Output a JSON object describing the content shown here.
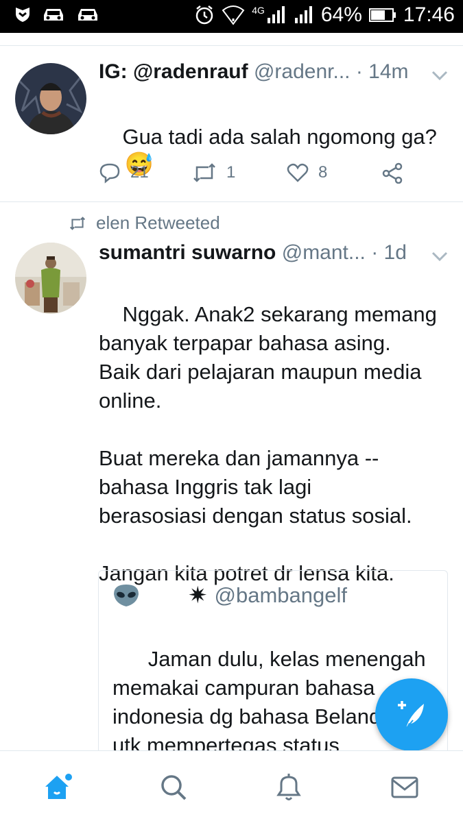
{
  "status_bar": {
    "network": "4G",
    "battery": "64%",
    "time": "17:46"
  },
  "tweets": [
    {
      "name": "IG: @radenrauf",
      "handle": "@radenr...",
      "time": "· 14m",
      "text": "Gua tadi ada salah ngomong ga?",
      "emoji": "😅",
      "replies": "21",
      "retweets": "1",
      "likes": "8"
    },
    {
      "retweet_label": "elen Retweeted",
      "name": "sumantri suwarno",
      "handle": "@mant...",
      "time": "· 1d",
      "text": "Nggak. Anak2 sekarang memang\nbanyak terpapar bahasa asing.\nBaik dari pelajaran maupun media\nonline.\n\nBuat mereka dan jamannya --\nbahasa Inggris tak lagi\nberasosiasi dengan status sosial.\n\nJangan kita potret dr lensa kita.",
      "quote": {
        "name": "✷",
        "handle": "@bambangelf",
        "text": "Jaman dulu, kelas menengah\nmemakai campuran bahasa\nindonesia dg bahasa Belanda\nutk mempertegas status\nsosialnya sbg orang terdidik. Ka"
      }
    }
  ],
  "bottom_nav": [
    "home-icon",
    "search-icon",
    "notifications-icon",
    "messages-icon"
  ],
  "colors": {
    "accent": "#1da1f2",
    "muted": "#657786",
    "text": "#14171a"
  }
}
